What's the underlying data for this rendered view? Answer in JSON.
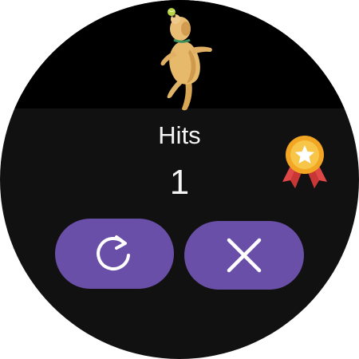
{
  "screen": {
    "stat_label": "Hits",
    "stat_value": "1"
  },
  "icons": {
    "character": "dancing-dog",
    "achievement": "award-medal-icon",
    "retry": "retry-icon",
    "close": "close-icon"
  },
  "colors": {
    "background": "#111111",
    "top_band": "#000000",
    "button": "#6a4fa8",
    "text": "#f4f4f4",
    "medal_gold": "#f2a623",
    "ribbon_red": "#e04848"
  }
}
